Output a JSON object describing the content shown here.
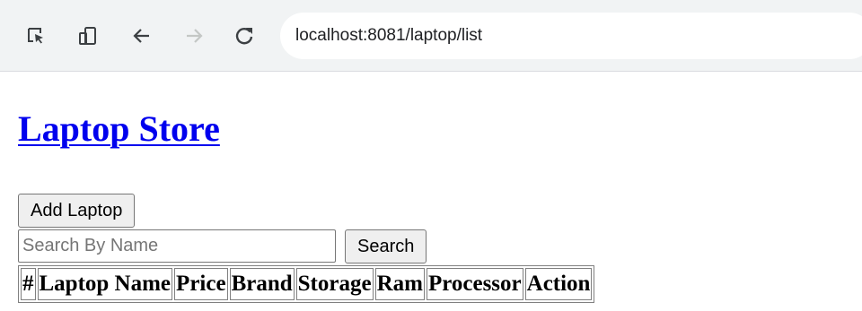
{
  "browser": {
    "url": "localhost:8081/laptop/list",
    "icons": [
      "inspect-icon",
      "device-toolbar-icon",
      "back-arrow-icon",
      "forward-arrow-icon",
      "reload-icon"
    ]
  },
  "page": {
    "title": "Laptop Store",
    "add_button_label": "Add Laptop",
    "search": {
      "placeholder": "Search By Name",
      "value": "",
      "button_label": "Search"
    },
    "table": {
      "headers": [
        "#",
        "Laptop Name",
        "Price",
        "Brand",
        "Storage",
        "Ram",
        "Processor",
        "Action"
      ],
      "rows": []
    }
  },
  "colors": {
    "toolbar_bg": "#f1f3f4",
    "link": "#0000ee",
    "button_bg": "#efefef",
    "disabled_icon": "#c4c7c5"
  }
}
